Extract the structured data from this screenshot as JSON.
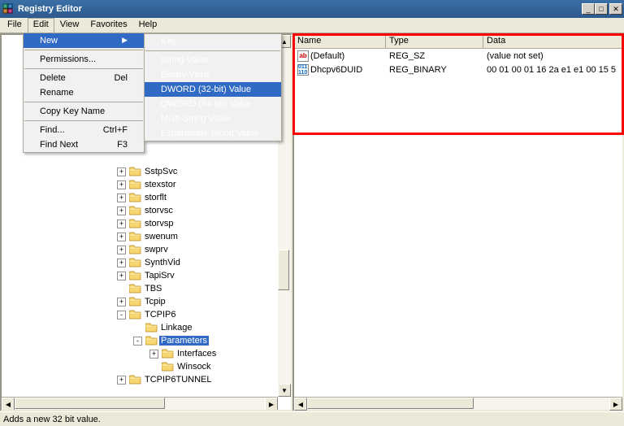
{
  "window": {
    "title": "Registry Editor"
  },
  "menubar": {
    "file": "File",
    "edit": "Edit",
    "view": "View",
    "favorites": "Favorites",
    "help": "Help"
  },
  "edit_menu": {
    "new": "New",
    "permissions": "Permissions...",
    "delete": "Delete",
    "delete_sc": "Del",
    "rename": "Rename",
    "copy_key": "Copy Key Name",
    "find": "Find...",
    "find_sc": "Ctrl+F",
    "find_next": "Find Next",
    "find_next_sc": "F3"
  },
  "new_submenu": {
    "key": "Key",
    "string": "String Value",
    "binary": "Binary Value",
    "dword": "DWORD (32-bit) Value",
    "qword": "QWORD (64-bit) Value",
    "multi": "Multi-String Value",
    "expandable": "Expandable String Value"
  },
  "tree_items": [
    {
      "indent": 140,
      "toggle": "+",
      "label": "SstpSvc"
    },
    {
      "indent": 140,
      "toggle": "+",
      "label": "stexstor"
    },
    {
      "indent": 140,
      "toggle": "+",
      "label": "storflt"
    },
    {
      "indent": 140,
      "toggle": "+",
      "label": "storvsc"
    },
    {
      "indent": 140,
      "toggle": "+",
      "label": "storvsp"
    },
    {
      "indent": 140,
      "toggle": "+",
      "label": "swenum"
    },
    {
      "indent": 140,
      "toggle": "+",
      "label": "swprv"
    },
    {
      "indent": 140,
      "toggle": "+",
      "label": "SynthVid"
    },
    {
      "indent": 140,
      "toggle": "+",
      "label": "TapiSrv"
    },
    {
      "indent": 140,
      "toggle": "",
      "label": "TBS"
    },
    {
      "indent": 140,
      "toggle": "+",
      "label": "Tcpip"
    },
    {
      "indent": 140,
      "toggle": "-",
      "label": "TCPIP6"
    },
    {
      "indent": 160,
      "toggle": "",
      "label": "Linkage"
    },
    {
      "indent": 160,
      "toggle": "-",
      "label": "Parameters",
      "selected": true
    },
    {
      "indent": 180,
      "toggle": "+",
      "label": "Interfaces"
    },
    {
      "indent": 180,
      "toggle": "",
      "label": "Winsock"
    },
    {
      "indent": 140,
      "toggle": "+",
      "label": "TCPIP6TUNNEL"
    }
  ],
  "list": {
    "headers": {
      "name": "Name",
      "type": "Type",
      "data": "Data"
    },
    "rows": [
      {
        "icon": "ab",
        "name": "(Default)",
        "type": "REG_SZ",
        "data": "(value not set)"
      },
      {
        "icon": "01",
        "name": "Dhcpv6DUID",
        "type": "REG_BINARY",
        "data": "00 01 00 01 16 2a e1 e1 00 15 5"
      }
    ]
  },
  "statusbar": {
    "text": "Adds a new 32 bit value."
  }
}
